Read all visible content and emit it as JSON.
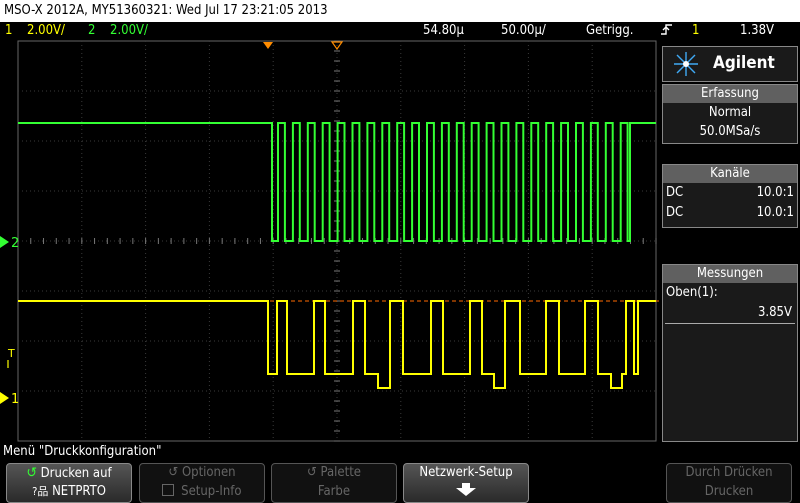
{
  "title_bar": {
    "text": "MSO-X 2012A, MY51360321: Wed Jul 17 23:21:05 2013"
  },
  "status": {
    "ch1_num": "1",
    "ch1_scale": "2.00V/",
    "ch2_num": "2",
    "ch2_scale": "2.00V/",
    "timebase": "54.80µ",
    "time_per_div": "50.00µ/",
    "trigger_mode": "Getrigg.",
    "trigger_source": "1",
    "trigger_level": "1.38V"
  },
  "markers": {
    "ch2_label": "2",
    "ch1_label": "1",
    "trigger_label": "T"
  },
  "side_panel": {
    "brand": "Agilent",
    "acquisition": {
      "header": "Erfassung",
      "mode": "Normal",
      "sample_rate": "50.0MSa/s"
    },
    "channels": {
      "header": "Kanäle",
      "rows": [
        {
          "coupling": "DC",
          "probe": "10.0:1",
          "color": "#ffff00"
        },
        {
          "coupling": "DC",
          "probe": "10.0:1",
          "color": "#33ff33"
        }
      ]
    },
    "measurements": {
      "header": "Messungen",
      "label": "Oben(1):",
      "value": "3.85V"
    }
  },
  "menu": {
    "label": "Menü \"Druckkonfiguration\""
  },
  "softkeys": {
    "print_line1": "Drucken auf",
    "print_line2": "NETPRTO",
    "options_line1": "Optionen",
    "options_line2": "Setup-Info",
    "palette_line1": "Palette",
    "palette_line2": "Farbe",
    "network_setup": "Netzwerk-Setup",
    "print_pressing_line1": "Durch Drücken",
    "print_pressing_line2": "Drucken"
  },
  "colors": {
    "ch1": "#ffff00",
    "ch2": "#33ff33",
    "grid": "#3a3a3a",
    "accent": "#33ff33"
  }
}
